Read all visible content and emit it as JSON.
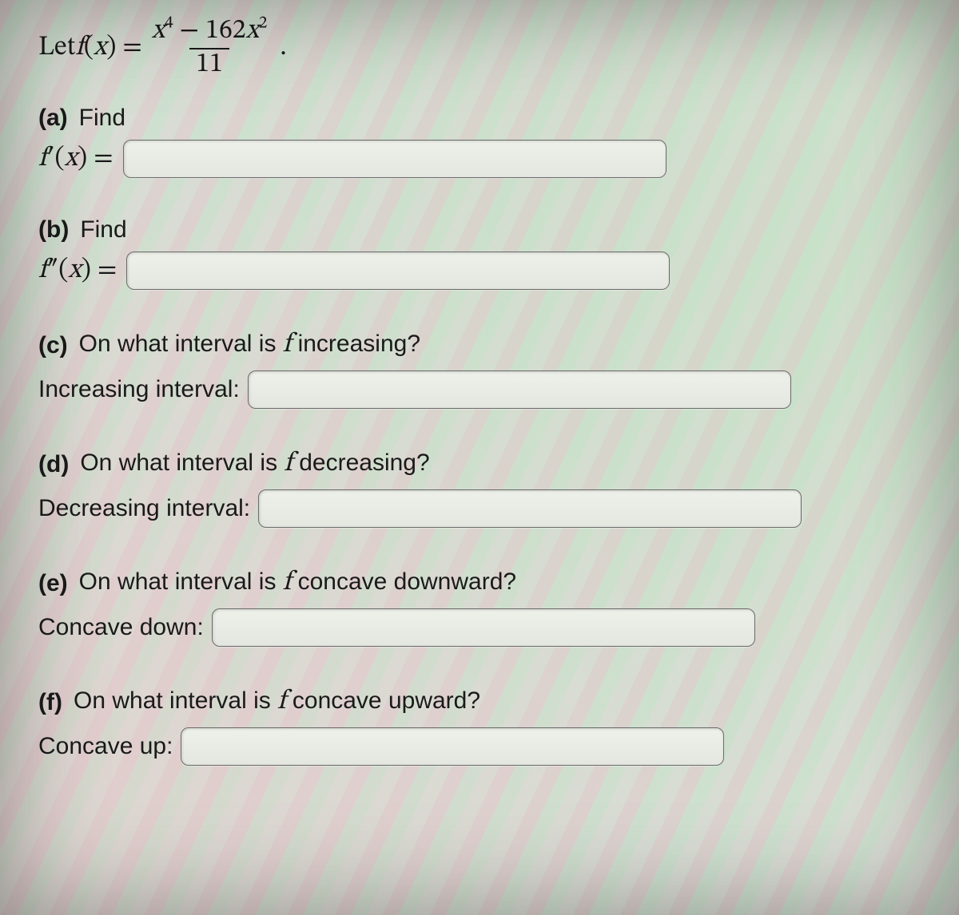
{
  "statement": {
    "let_prefix": "Let ",
    "fn_name": "f",
    "fn_arg": "x",
    "equals": "=",
    "numerator_terms": {
      "x4": "x",
      "exp4": "4",
      "minus": " − ",
      "coef": "162",
      "x2": "x",
      "exp2": "2"
    },
    "denominator": "11",
    "period": "."
  },
  "parts": {
    "a": {
      "label": "(a)",
      "find": "Find",
      "lhs_fn": "f",
      "lhs_prime": "′",
      "lhs_arg": "x",
      "lhs_eq": "=",
      "value": ""
    },
    "b": {
      "label": "(b)",
      "find": "Find",
      "lhs_fn": "f",
      "lhs_prime": "″",
      "lhs_arg": "x",
      "lhs_eq": "=",
      "value": ""
    },
    "c": {
      "label": "(c)",
      "question_pre": "On what interval is ",
      "question_fn": "f",
      "question_post": " increasing?",
      "answer_label": "Increasing interval:",
      "value": ""
    },
    "d": {
      "label": "(d)",
      "question_pre": "On what interval is ",
      "question_fn": "f",
      "question_post": " decreasing?",
      "answer_label": "Decreasing interval:",
      "value": ""
    },
    "e": {
      "label": "(e)",
      "question_pre": "On what interval is ",
      "question_fn": "f",
      "question_post": " concave downward?",
      "answer_label": "Concave down:",
      "value": ""
    },
    "f": {
      "label": "(f)",
      "question_pre": "On what interval is ",
      "question_fn": "f",
      "question_post": " concave upward?",
      "answer_label": "Concave up:",
      "value": ""
    }
  }
}
